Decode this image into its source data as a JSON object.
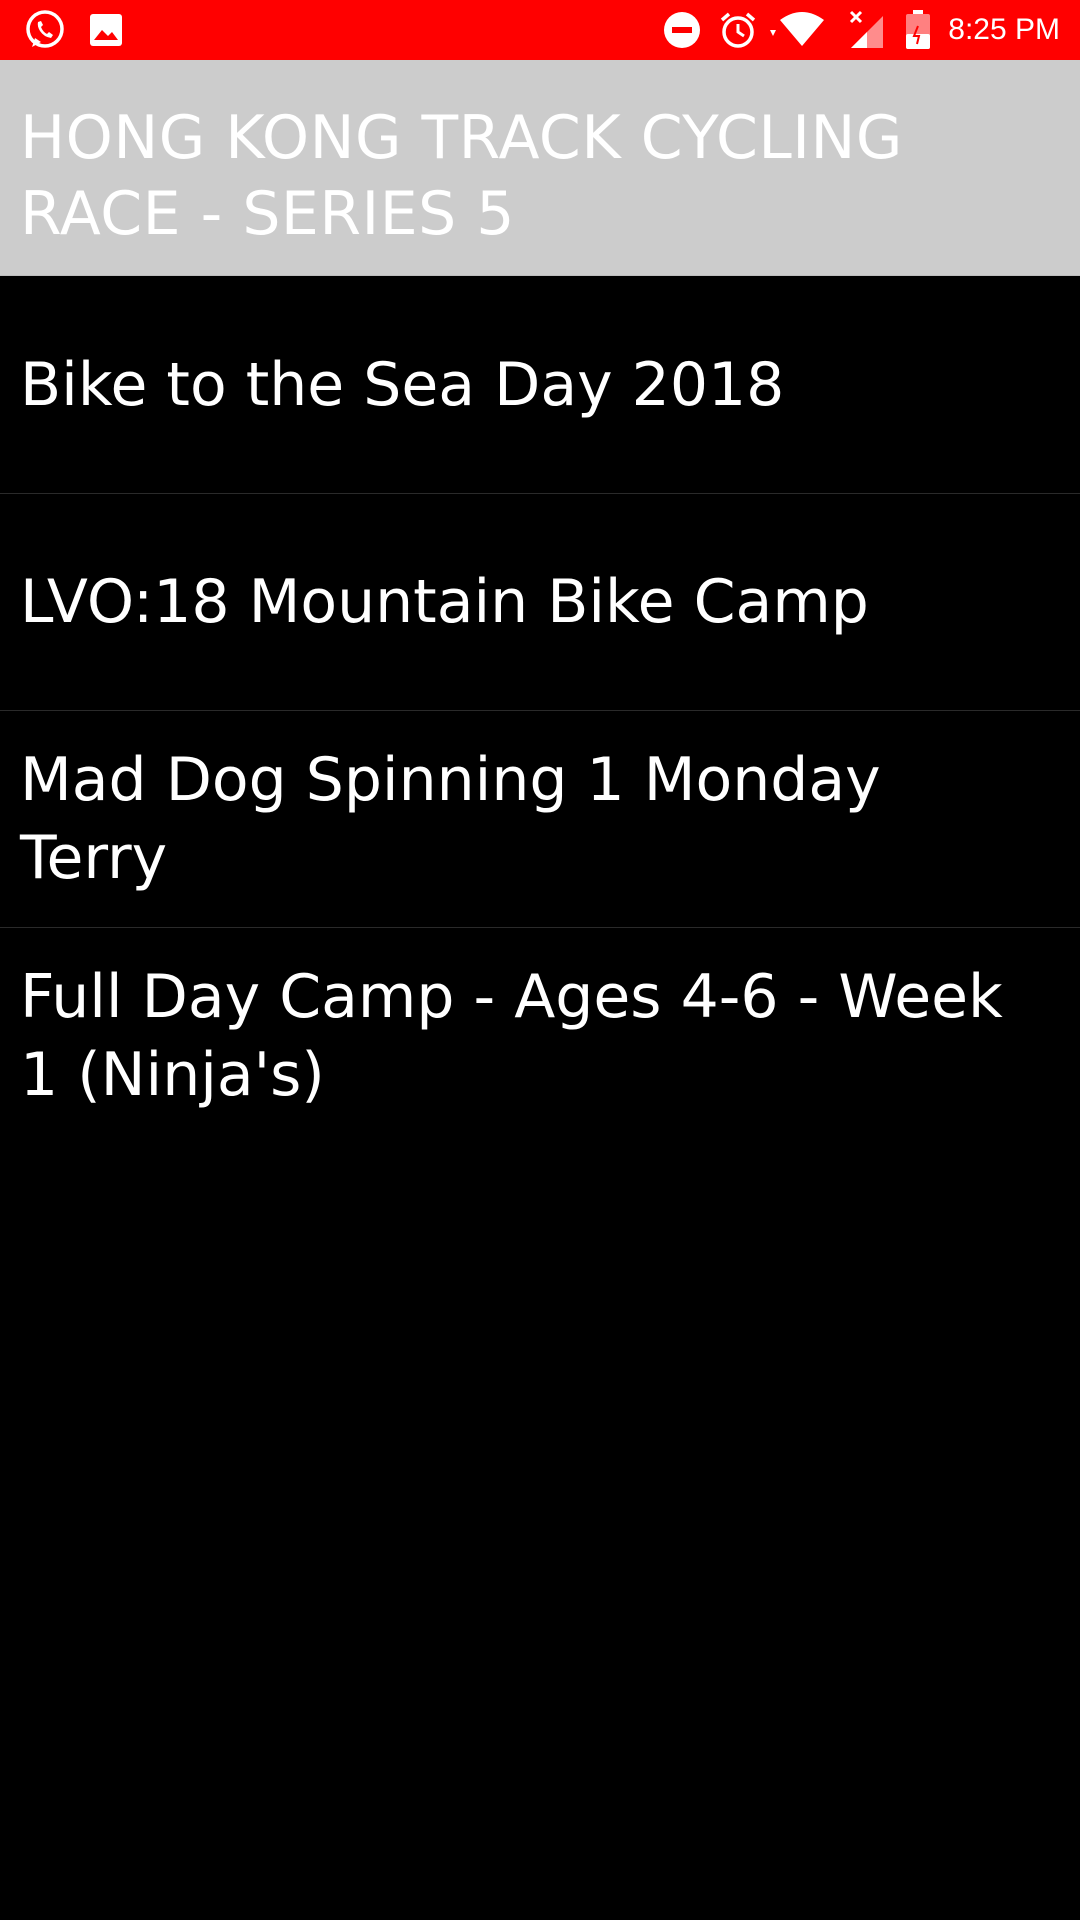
{
  "status_bar": {
    "background": "#ff0000",
    "left_icons": [
      "whatsapp-icon",
      "gallery-icon"
    ],
    "right_icons": [
      "do-not-disturb-icon",
      "alarm-icon",
      "wifi-icon",
      "signal-icon",
      "battery-icon"
    ],
    "time": "8:25 PM"
  },
  "header": {
    "title": "HONG KONG TRACK CYCLING RACE - SERIES 5",
    "background": "#cccccc"
  },
  "list": {
    "items": [
      {
        "label": "Bike to the Sea Day 2018"
      },
      {
        "label": "LVO:18 Mountain Bike Camp"
      },
      {
        "label": "Mad Dog Spinning 1 Monday Terry"
      },
      {
        "label": "Full Day Camp - Ages 4-6 - Week 1 (Ninja's)"
      }
    ]
  }
}
